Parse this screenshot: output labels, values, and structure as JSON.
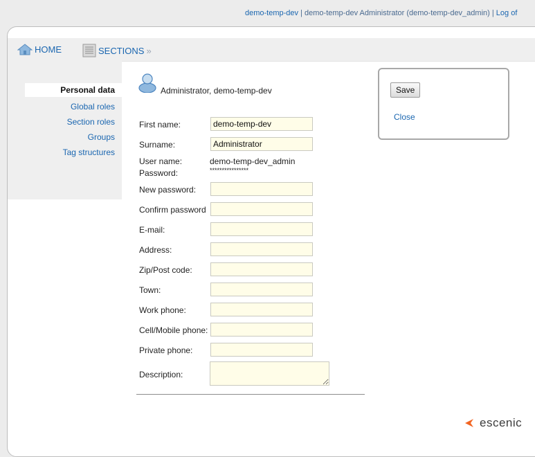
{
  "topbar": {
    "site_link": "demo-temp-dev",
    "separator": " | ",
    "user_info": "demo-temp-dev Administrator (demo-temp-dev_admin)",
    "separator2": " | ",
    "logout_link": "Log of"
  },
  "nav": {
    "home_label": "HOME",
    "sections_label": "SECTIONS",
    "sections_suffix": "»"
  },
  "sidebar": {
    "items": [
      {
        "label": "Personal data",
        "active": true
      },
      {
        "label": "Global roles"
      },
      {
        "label": "Section roles"
      },
      {
        "label": "Groups"
      },
      {
        "label": "Tag structures"
      }
    ]
  },
  "header": {
    "display_name": "Administrator, demo-temp-dev"
  },
  "form": {
    "first_name": {
      "label": "First name:",
      "value": "demo-temp-dev"
    },
    "surname": {
      "label": "Surname:",
      "value": "Administrator"
    },
    "user_name": {
      "label": "User name:",
      "value": "demo-temp-dev_admin"
    },
    "password": {
      "label": "Password:",
      "value": "****************"
    },
    "new_password": {
      "label": "New password:",
      "value": ""
    },
    "confirm_password": {
      "label": "Confirm password",
      "value": ""
    },
    "email": {
      "label": "E-mail:",
      "value": ""
    },
    "address": {
      "label": "Address:",
      "value": ""
    },
    "zip": {
      "label": "Zip/Post code:",
      "value": ""
    },
    "town": {
      "label": "Town:",
      "value": ""
    },
    "work_phone": {
      "label": "Work phone:",
      "value": ""
    },
    "mobile_phone": {
      "label": "Cell/Mobile phone:",
      "value": ""
    },
    "private_phone": {
      "label": "Private phone:",
      "value": ""
    },
    "description": {
      "label": "Description:",
      "value": ""
    }
  },
  "actions": {
    "save_label": "Save",
    "close_label": "Close"
  },
  "logo": {
    "wordmark": "escenic",
    "accent_color": "#f26522"
  }
}
